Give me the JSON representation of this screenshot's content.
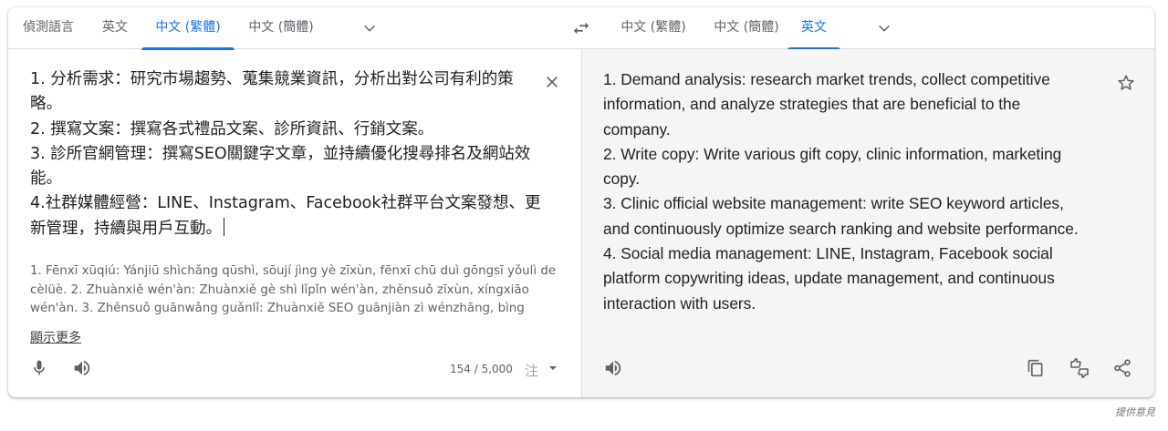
{
  "source_tabs": [
    {
      "label": "偵測語言",
      "active": false
    },
    {
      "label": "英文",
      "active": false
    },
    {
      "label": "中文 (繁體)",
      "active": true
    },
    {
      "label": "中文 (簡體)",
      "active": false
    }
  ],
  "target_tabs": [
    {
      "label": "中文 (繁體)",
      "active": false
    },
    {
      "label": "中文 (簡體)",
      "active": false
    },
    {
      "label": "英文",
      "active": true
    }
  ],
  "source": {
    "lines": [
      "1. 分析需求：研究市場趨勢、蒐集競業資訊，分析出對公司有利的策",
      "略。",
      "2. 撰寫文案：撰寫各式禮品文案、診所資訊、行銷文案。",
      "3. 診所官網管理：撰寫SEO關鍵字文章，並持續優化搜尋排名及網站效",
      "能。",
      "4.社群媒體經營：LINE、Instagram、Facebook社群平台文案發想、更",
      "新管理，持續與用戶互動。"
    ],
    "transliteration": "1. Fēnxī xūqiú: Yánjiū shìchǎng qūshì, sōují jìng yè zīxùn, fēnxī chū duì gōngsī yǒulì de cèlüè. 2. Zhuànxiě wén'àn: Zhuànxiě gè shì lǐpǐn wén'àn, zhěnsuǒ zīxùn, xíngxiāo wén'àn. 3. Zhěnsuǒ guānwǎng guǎnlǐ: Zhuànxiě SEO guānjiàn zì wénzhāng, bìng chíxù yōuhuà",
    "show_more": "顯示更多",
    "char_count": "154 / 5,000",
    "input_method_glyph": "注"
  },
  "target": {
    "lines": [
      "1. Demand analysis: research market trends, collect competitive",
      "information, and analyze strategies that are beneficial to the",
      "company.",
      "2. Write copy: Write various gift copy, clinic information, marketing",
      "copy.",
      "3. Clinic official website management: write SEO keyword articles,",
      "and continuously optimize search ranking and website performance.",
      "4. Social media management: LINE, Instagram, Facebook social",
      "platform copywriting ideas, update management, and continuous",
      "interaction with users."
    ]
  },
  "feedback_link": "提供意見",
  "icons": {
    "more_source": "chevron-down-icon",
    "swap": "swap-languages-icon",
    "more_target": "chevron-down-icon",
    "clear": "close-icon",
    "star": "star-outline-icon",
    "mic": "mic-icon",
    "listen": "volume-icon",
    "copy": "copy-icon",
    "rate": "thumbs-up-down-icon",
    "share": "share-icon"
  },
  "colors": {
    "accent": "#1a73e8",
    "text": "#202124",
    "secondary": "#5f6368",
    "target_bg": "#f5f5f5"
  }
}
